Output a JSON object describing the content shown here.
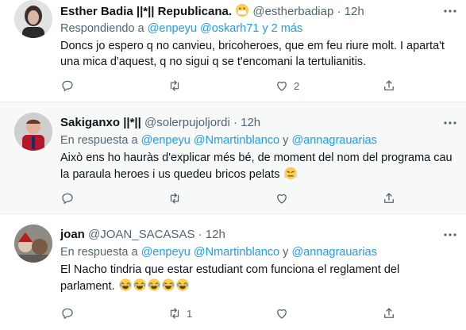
{
  "tweets": [
    {
      "name": "Esther Badia ||*|| Republicana.",
      "name_emoji": "mask-face",
      "handle": "@estherbadiap",
      "dot": "·",
      "time": "12h",
      "reply_prefix": "Respondiendo a",
      "mentions": [
        "@enpeyu",
        "@oskarh71"
      ],
      "reply_suffix": "y 2 más",
      "text": "Doncs jo espero q no canvieu, bricoheroes, que em feu riure molt. I aparta't una mica d'aquest, q no sigui q se t'encomani la tertulianitis.",
      "counts": {
        "reply": "",
        "retweet": "",
        "like": "2",
        "share": ""
      }
    },
    {
      "name": "Sakiganxo ||*||",
      "handle": "@solerpujoljordi",
      "dot": "·",
      "time": "12h",
      "reply_prefix": "En respuesta a",
      "mentions": [
        "@enpeyu",
        "@Nmartinblanco"
      ],
      "reply_conj": "y",
      "mention3": "@annagrauarias",
      "text": "Això ens ho hauràs d'explicar més bé, de moment del nom del programa cau la paraula heroes i us quedeu bricos pelats",
      "text_emoji": "steaming-face",
      "counts": {
        "reply": "",
        "retweet": "",
        "like": "",
        "share": ""
      }
    },
    {
      "name": "joan",
      "handle": "@JOAN_SACASAS",
      "dot": "·",
      "time": "12h",
      "reply_prefix": "En respuesta a",
      "mentions": [
        "@enpeyu",
        "@Nmartinblanco"
      ],
      "reply_conj": "y",
      "mention3": "@annagrauarias",
      "text": "El Nacho tindria que estar estudiant com funciona el reglament del parlament.",
      "text_emoji": "laughing-tears-face x5",
      "counts": {
        "reply": "",
        "retweet": "1",
        "like": "",
        "share": ""
      }
    }
  ],
  "colors": {
    "link": "#1d9bf0",
    "secondary": "#536471",
    "hover_bg": "#f7f9f9",
    "divider": "#e6ecf0"
  },
  "icons": [
    "reply-icon",
    "retweet-icon",
    "like-icon",
    "share-icon",
    "more-icon"
  ]
}
